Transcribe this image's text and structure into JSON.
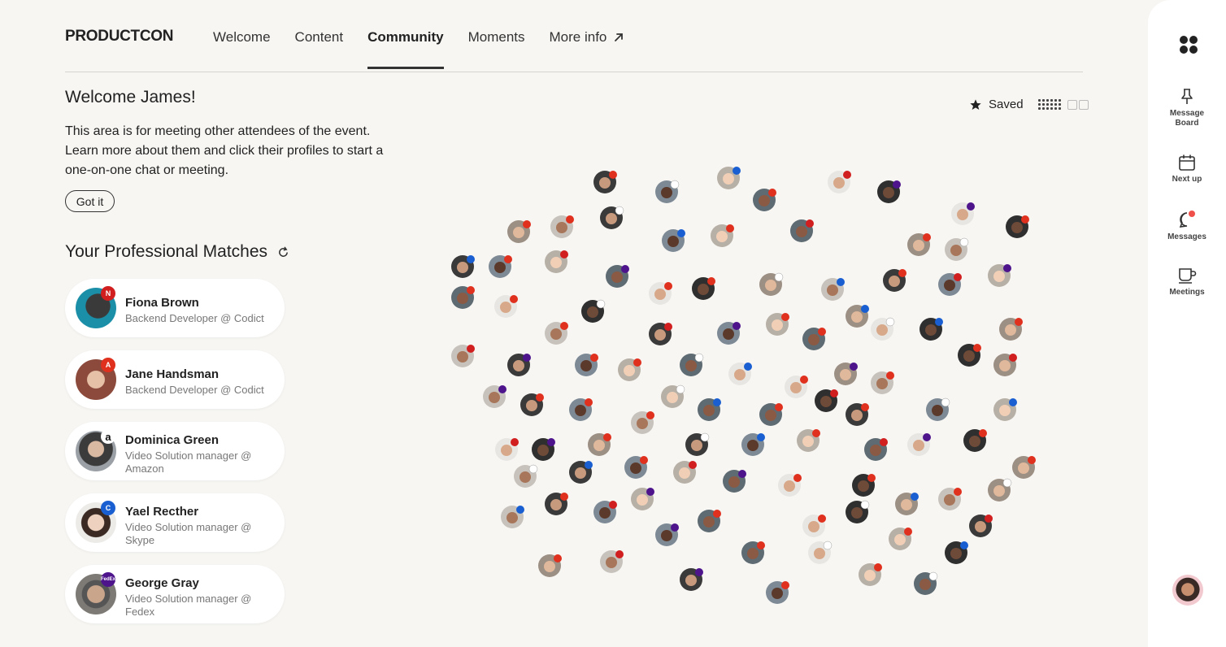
{
  "app": {
    "logo": "PRODUCTCON"
  },
  "nav": {
    "items": [
      "Welcome",
      "Content",
      "Community",
      "Moments",
      "More info"
    ],
    "active": "Community"
  },
  "welcome": {
    "title": "Welcome James!",
    "text": "This area is for meeting other attendees of the event. Learn more about them and click their profiles to start a one-on-one chat or meeting.",
    "button": "Got it"
  },
  "matches": {
    "title": "Your Professional Matches",
    "items": [
      {
        "name": "Fiona Brown",
        "role": "Backend Developer @ Codict",
        "company_badge": "N",
        "badge_color": "#d11f1f",
        "avatar_color": "#1c8fa8"
      },
      {
        "name": "Jane Handsman",
        "role": "Backend Developer @ Codict",
        "company_badge": "A",
        "badge_color": "#e0301e",
        "avatar_color": "#8c4a3c"
      },
      {
        "name": "Dominica Green",
        "role": "Video Solution manager @ Amazon",
        "company_badge": "a",
        "badge_color": "#ffffff",
        "avatar_color": "#5a5f66"
      },
      {
        "name": "Yael Recther",
        "role": "Video Solution manager @ Skype",
        "company_badge": "C",
        "badge_color": "#1a5fd1",
        "avatar_color": "#d9d4cf"
      },
      {
        "name": "George Gray",
        "role": "Video Solution manager @ Fedex",
        "company_badge": "FedEx",
        "badge_color": "#4d148c",
        "avatar_color": "#7d7a75"
      }
    ]
  },
  "view": {
    "saved_label": "Saved"
  },
  "sidebar": {
    "items": [
      {
        "label": "Message Board",
        "icon": "pin-icon"
      },
      {
        "label": "Next up",
        "icon": "calendar-icon"
      },
      {
        "label": "Messages",
        "icon": "chat-icon",
        "has_notification": true
      },
      {
        "label": "Meetings",
        "icon": "coffee-cup-icon"
      }
    ]
  },
  "colors": {
    "background": "#f7f6f3",
    "accent": "#333333",
    "adobe_badge": "#e0301e",
    "skype_badge": "#1a5fd1",
    "fedex_badge": "#4d148c",
    "notification": "#f0504a"
  }
}
